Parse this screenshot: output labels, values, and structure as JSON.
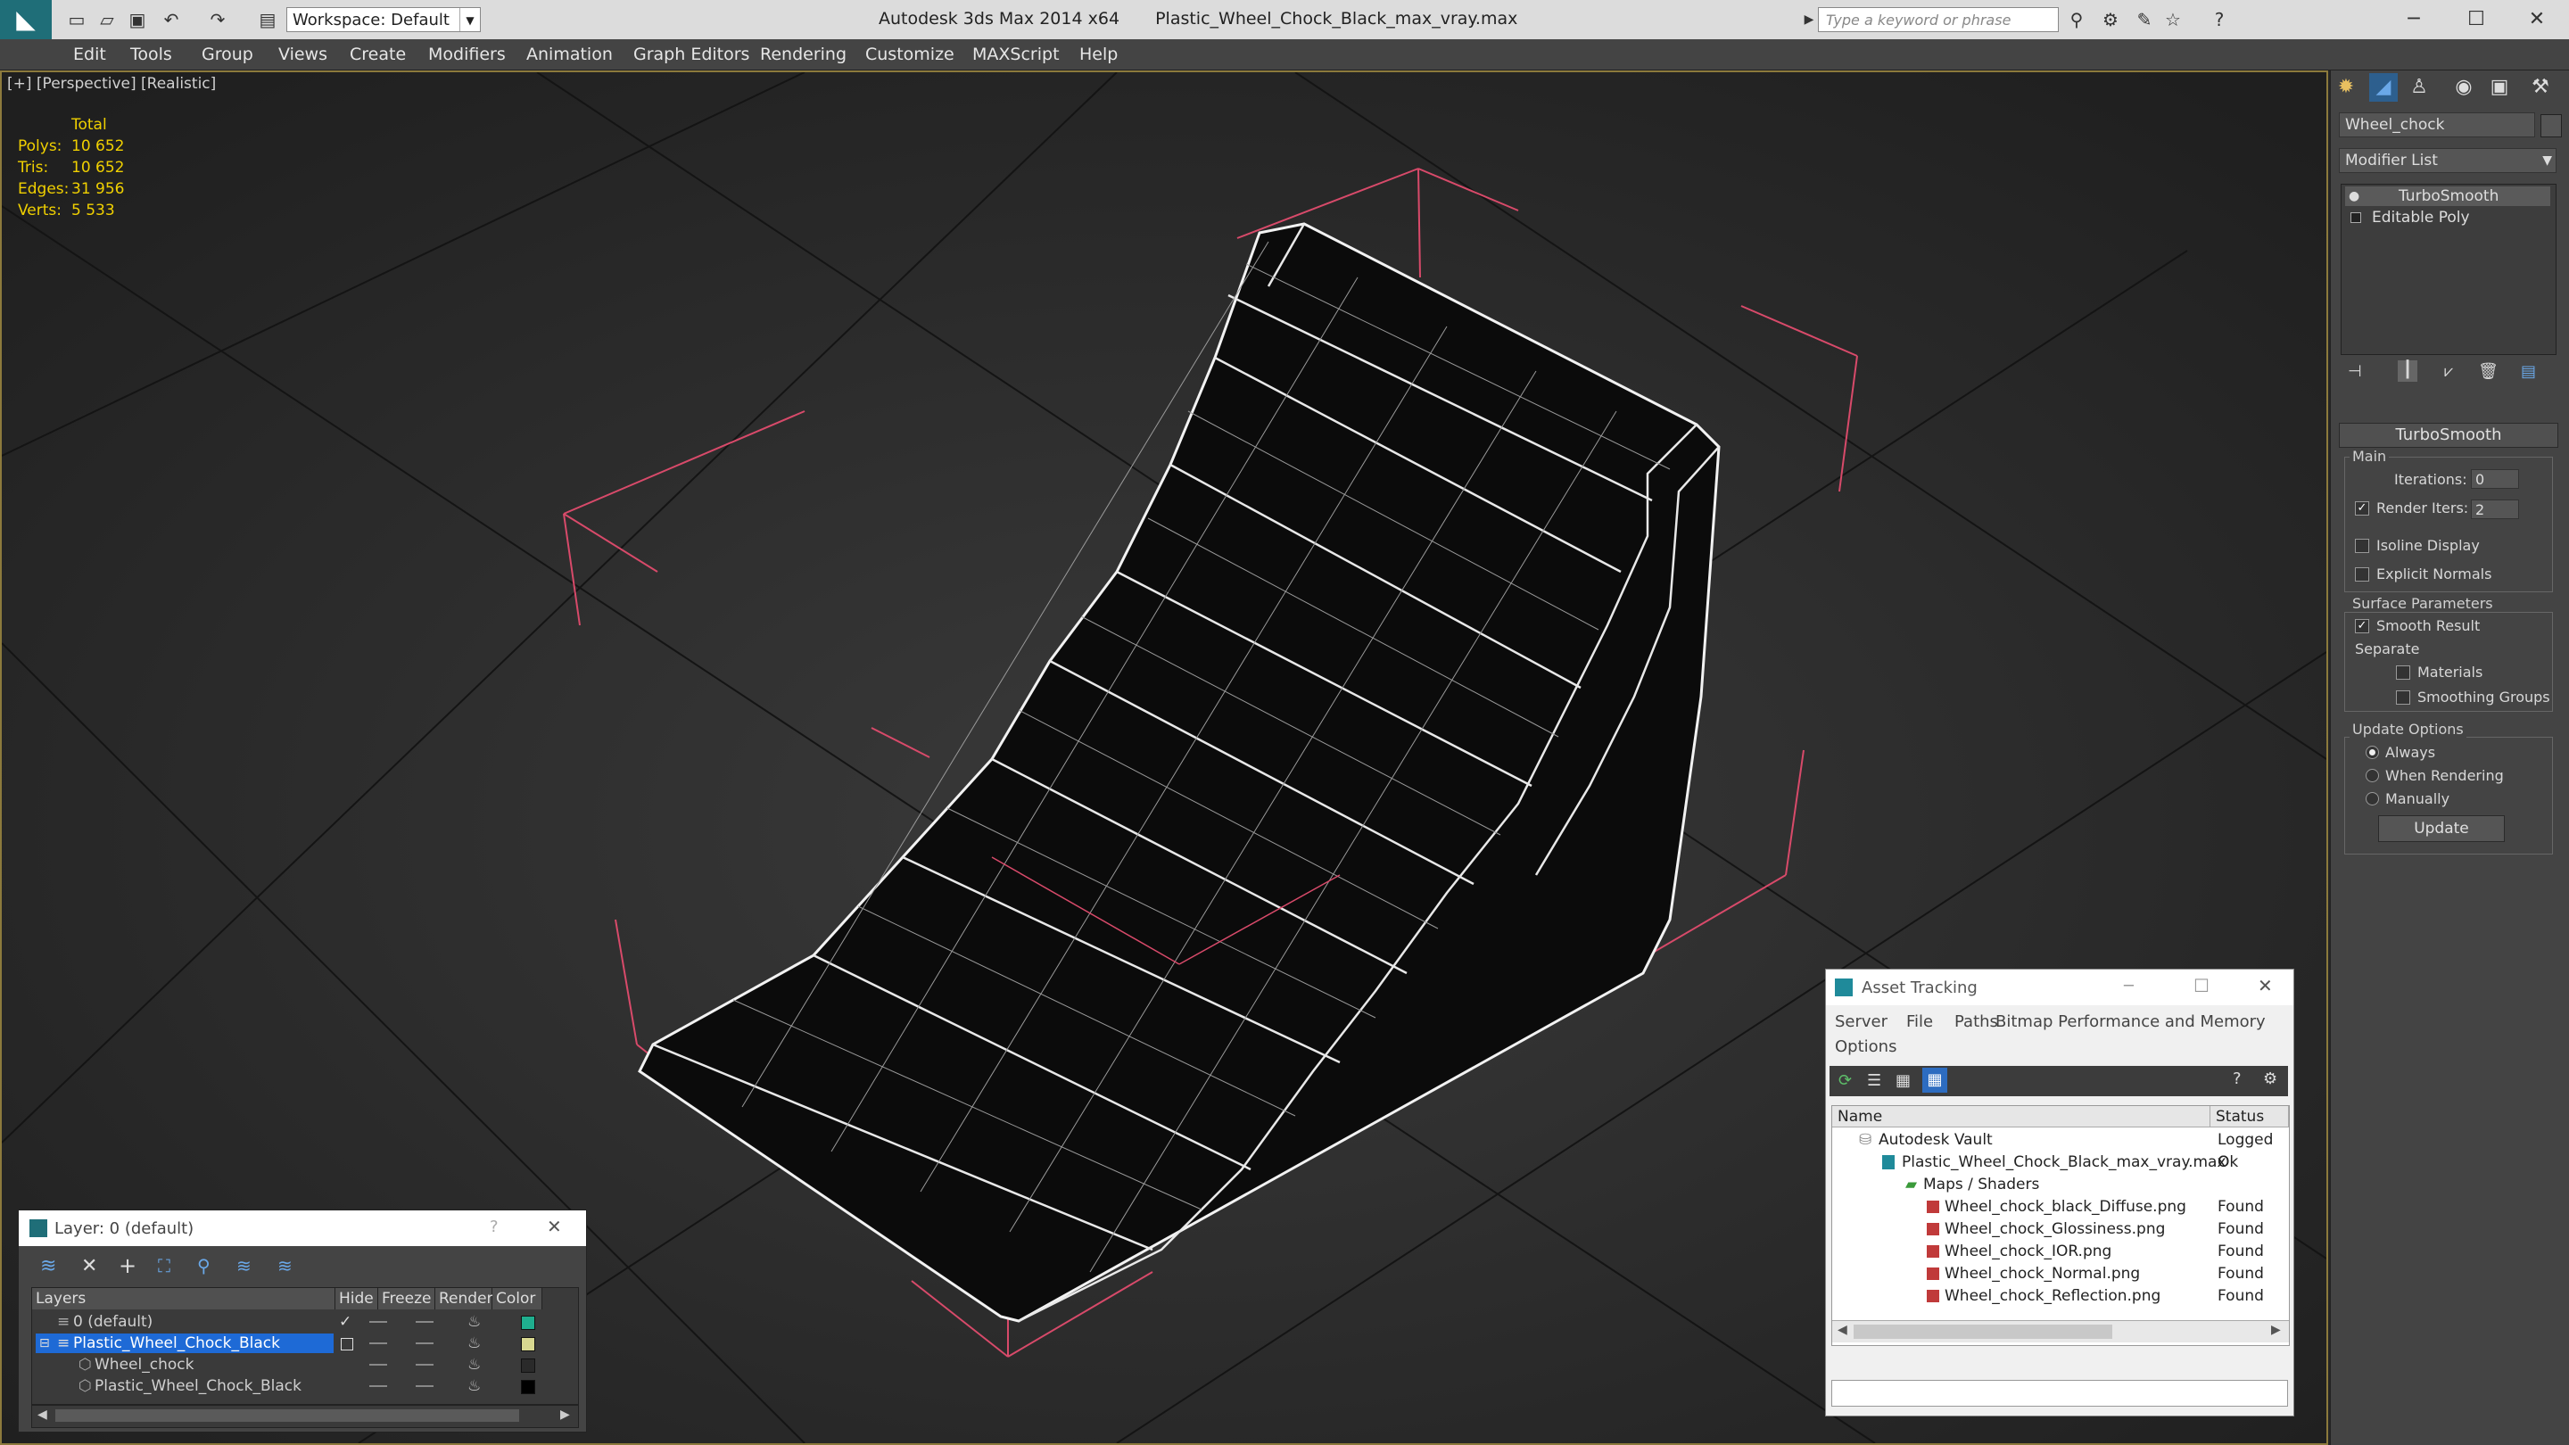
{
  "window": {
    "app_title": "Autodesk 3ds Max  2014 x64",
    "file_title": "Plastic_Wheel_Chock_Black_max_vray.max",
    "workspace": "Workspace: Default",
    "search_placeholder": "Type a keyword or phrase"
  },
  "menu": [
    "Edit",
    "Tools",
    "Group",
    "Views",
    "Create",
    "Modifiers",
    "Animation",
    "Graph Editors",
    "Rendering",
    "Customize",
    "MAXScript",
    "Help"
  ],
  "viewport": {
    "label": "[+] [Perspective] [Realistic]",
    "stats": {
      "header": "Total",
      "rows": [
        {
          "k": "Polys:",
          "v": "10 652"
        },
        {
          "k": "Tris:",
          "v": "10 652"
        },
        {
          "k": "Edges:",
          "v": "31 956"
        },
        {
          "k": "Verts:",
          "v": "5 533"
        }
      ]
    }
  },
  "command_panel": {
    "object_name": "Wheel_chock",
    "modifier_list": "Modifier List",
    "stack": [
      "TurboSmooth",
      "Editable Poly"
    ],
    "rollout_title": "TurboSmooth",
    "main_label": "Main",
    "iterations_label": "Iterations:",
    "iterations_value": "0",
    "render_iters_label": "Render Iters:",
    "render_iters_value": "2",
    "isoline_label": "Isoline Display",
    "explicit_label": "Explicit Normals",
    "surface_label": "Surface Parameters",
    "smooth_result_label": "Smooth Result",
    "separate_label": "Separate",
    "materials_label": "Materials",
    "smoothing_groups_label": "Smoothing Groups",
    "update_options_label": "Update Options",
    "always_label": "Always",
    "when_rendering_label": "When Rendering",
    "manually_label": "Manually",
    "update_button": "Update"
  },
  "asset_tracking": {
    "title": "Asset Tracking",
    "menu": [
      "Server",
      "File",
      "Paths",
      "Bitmap Performance and Memory",
      "Options"
    ],
    "col_name": "Name",
    "col_status": "Status",
    "rows": [
      {
        "name": "Autodesk Vault",
        "status": "Logged O",
        "indent": 0
      },
      {
        "name": "Plastic_Wheel_Chock_Black_max_vray.max",
        "status": "Ok",
        "indent": 1
      },
      {
        "name": "Maps / Shaders",
        "status": "",
        "indent": 2
      },
      {
        "name": "Wheel_chock_black_Diffuse.png",
        "status": "Found",
        "indent": 3
      },
      {
        "name": "Wheel_chock_Glossiness.png",
        "status": "Found",
        "indent": 3
      },
      {
        "name": "Wheel_chock_IOR.png",
        "status": "Found",
        "indent": 3
      },
      {
        "name": "Wheel_chock_Normal.png",
        "status": "Found",
        "indent": 3
      },
      {
        "name": "Wheel_chock_Reflection.png",
        "status": "Found",
        "indent": 3
      }
    ]
  },
  "layer_window": {
    "title": "Layer: 0 (default)",
    "help": "?",
    "columns": [
      "Layers",
      "Hide",
      "Freeze",
      "Render",
      "Color"
    ],
    "rows": [
      {
        "name": "0 (default)",
        "color": "#1fae8e"
      },
      {
        "name": "Plastic_Wheel_Chock_Black",
        "color": "#d8d890"
      },
      {
        "name": "Wheel_chock",
        "color": "#2a2a2a"
      },
      {
        "name": "Plastic_Wheel_Chock_Black",
        "color": "#000000"
      }
    ]
  },
  "colors": {
    "selection_blue": "#1e6ad6",
    "viewport_border": "#8c7a3c",
    "stats_yellow": "#f0d000",
    "bbox_pink": "#d84a6a"
  }
}
